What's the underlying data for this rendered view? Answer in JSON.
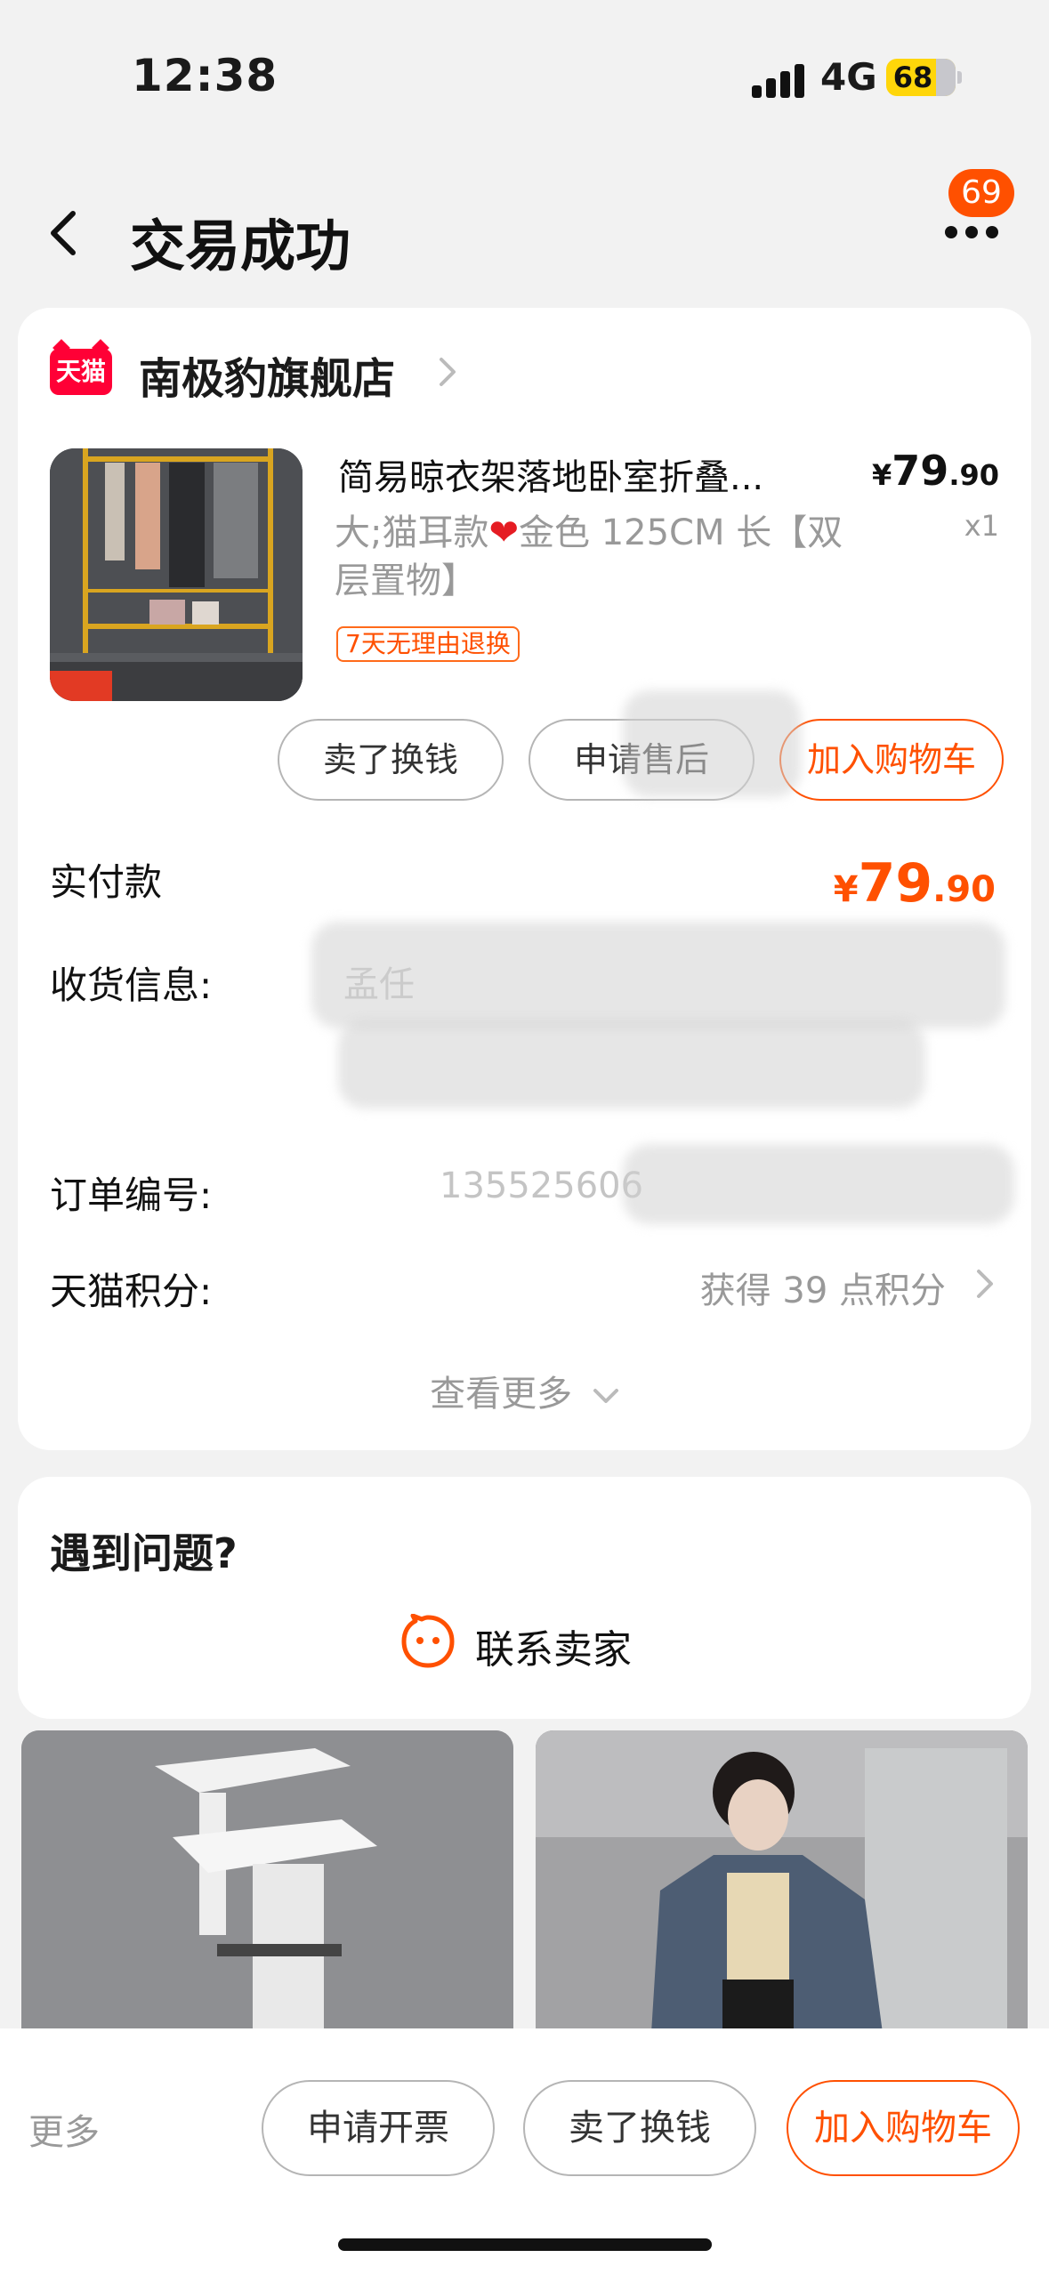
{
  "status_bar": {
    "time": "12:38",
    "network": "4G",
    "battery": "68"
  },
  "header": {
    "title": "交易成功",
    "badge": "69"
  },
  "order": {
    "shop": {
      "logo_text": "天猫",
      "name": "南极豹旗舰店"
    },
    "item": {
      "title": "简易晾衣架落地卧室折叠...",
      "spec_prefix": "大;猫耳款",
      "spec_suffix": "金色 125CM 长【双层置物】",
      "return_tag": "7天无理由退换",
      "price_symbol": "¥",
      "price_int": "79",
      "price_dec": ".90",
      "quantity": "x1"
    },
    "actions": {
      "sell": "卖了换钱",
      "after_sale": "申请售后",
      "add_cart": "加入购物车"
    },
    "paid": {
      "label": "实付款",
      "symbol": "¥",
      "int": "79",
      "dec": ".90"
    },
    "shipping": {
      "label": "收货信息:",
      "value": "孟任"
    },
    "order_no": {
      "label": "订单编号:",
      "value": "135525606"
    },
    "points": {
      "label": "天猫积分:",
      "value": "获得 39 点积分"
    },
    "see_more": "查看更多"
  },
  "problem": {
    "title": "遇到问题?",
    "contact_label": "联系卖家"
  },
  "bottom_bar": {
    "more": "更多",
    "invoice": "申请开票",
    "sell": "卖了换钱",
    "add_cart": "加入购物车"
  },
  "colors": {
    "accent": "#ff5000",
    "tmall": "#ff0036"
  },
  "icons": [
    "back-icon",
    "more-icon",
    "chevron-right-icon",
    "chevron-down-icon",
    "seller-chat-icon"
  ]
}
